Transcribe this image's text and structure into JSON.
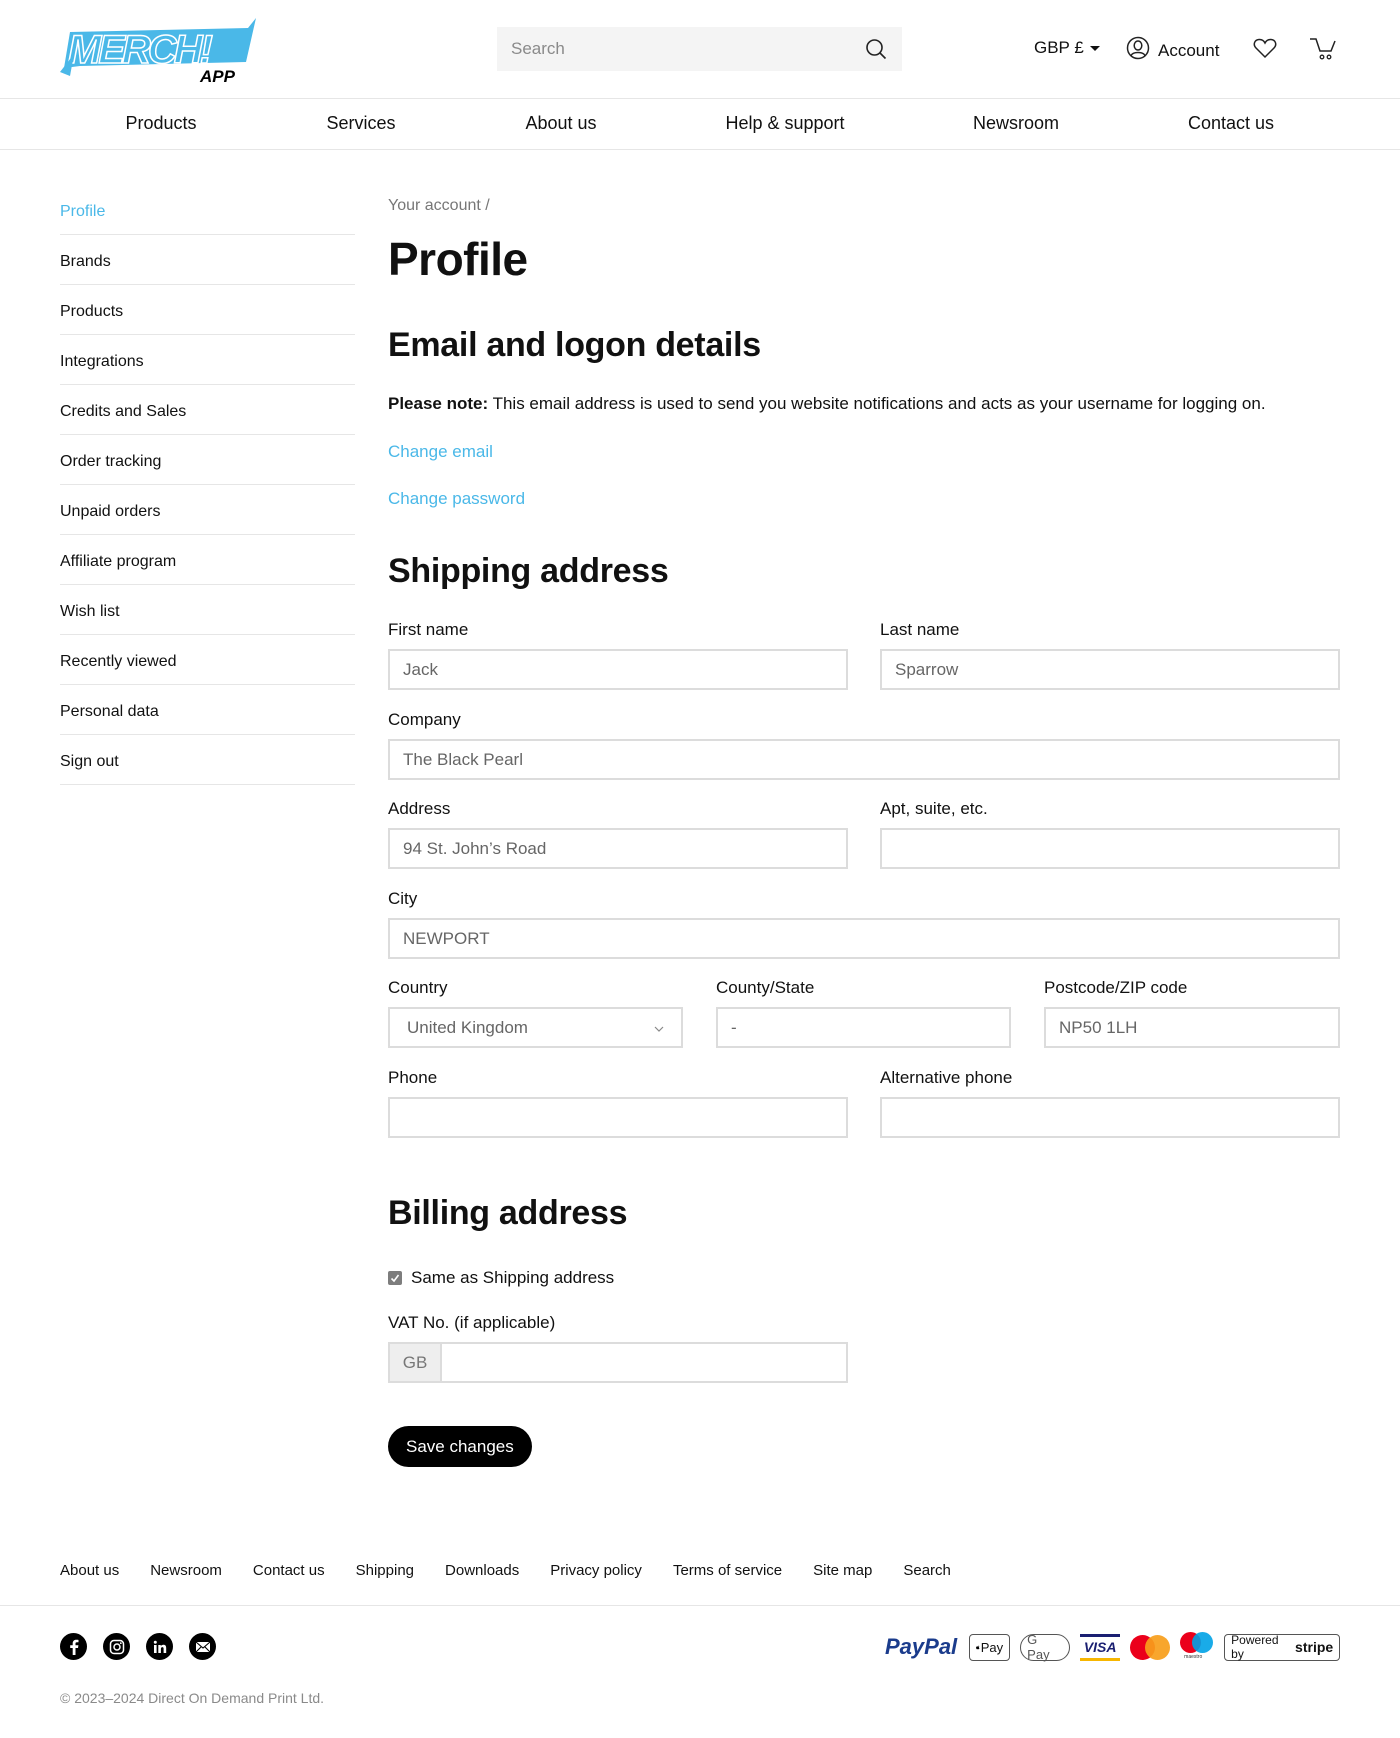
{
  "brand": {
    "name": "MERCH!",
    "sub": "APP",
    "accent_color": "#4ab8e8"
  },
  "header": {
    "search_placeholder": "Search",
    "search_icon": "search-icon",
    "currency": "GBP £",
    "account_label": "Account",
    "account_icon": "user-circle-icon",
    "wishlist_icon": "heart-icon",
    "cart_icon": "cart-icon"
  },
  "nav": {
    "items": [
      {
        "label": "Products"
      },
      {
        "label": "Services"
      },
      {
        "label": "About us"
      },
      {
        "label": "Help & support"
      },
      {
        "label": "Newsroom"
      },
      {
        "label": "Contact us"
      }
    ]
  },
  "sidebar": {
    "active_index": 0,
    "items": [
      {
        "label": "Profile"
      },
      {
        "label": "Brands"
      },
      {
        "label": "Products"
      },
      {
        "label": "Integrations"
      },
      {
        "label": "Credits and Sales"
      },
      {
        "label": "Order tracking"
      },
      {
        "label": "Unpaid orders"
      },
      {
        "label": "Affiliate program"
      },
      {
        "label": "Wish list"
      },
      {
        "label": "Recently viewed"
      },
      {
        "label": "Personal data"
      },
      {
        "label": "Sign out"
      }
    ]
  },
  "main": {
    "breadcrumb": "Your account /",
    "title": "Profile",
    "email_section": {
      "heading": "Email and logon details",
      "note_bold": "Please note:",
      "note_text": " This email address is used to send you website notifications and acts as your username for logging on.",
      "change_email": "Change email",
      "change_password": "Change password"
    },
    "shipping": {
      "heading": "Shipping address",
      "first_name": {
        "label": "First name",
        "value": "Jack"
      },
      "last_name": {
        "label": "Last name",
        "value": "Sparrow"
      },
      "company": {
        "label": "Company",
        "value": "The Black Pearl"
      },
      "address": {
        "label": "Address",
        "value": "94 St. John’s Road"
      },
      "apt": {
        "label": "Apt, suite, etc.",
        "value": ""
      },
      "city": {
        "label": "City",
        "value": "NEWPORT"
      },
      "country": {
        "label": "Country",
        "value": "United Kingdom"
      },
      "county": {
        "label": "County/State",
        "value": "-"
      },
      "postcode": {
        "label": "Postcode/ZIP code",
        "value": "NP50 1LH"
      },
      "phone": {
        "label": "Phone",
        "value": ""
      },
      "alt_phone": {
        "label": "Alternative phone",
        "value": ""
      }
    },
    "billing": {
      "heading": "Billing address",
      "same_as_shipping_label": "Same as Shipping address",
      "same_as_shipping_checked": true,
      "vat_label": "VAT No. (if applicable)",
      "vat_prefix": "GB",
      "vat_value": ""
    },
    "save_label": "Save changes"
  },
  "footer": {
    "links": [
      {
        "label": "About us"
      },
      {
        "label": "Newsroom"
      },
      {
        "label": "Contact us"
      },
      {
        "label": "Shipping"
      },
      {
        "label": "Downloads"
      },
      {
        "label": "Privacy policy"
      },
      {
        "label": "Terms of service"
      },
      {
        "label": "Site map"
      },
      {
        "label": "Search"
      }
    ],
    "social": [
      "facebook-icon",
      "instagram-icon",
      "linkedin-icon",
      "email-icon"
    ],
    "copyright": "© 2023–2024 Direct On Demand Print Ltd.",
    "payments": {
      "paypal": "PayPal",
      "applepay": "Pay",
      "googlepay": "G Pay",
      "visa": "VISA",
      "maestro_caption": "maestro",
      "stripe_prefix": "Powered by",
      "stripe_name": "stripe"
    }
  }
}
